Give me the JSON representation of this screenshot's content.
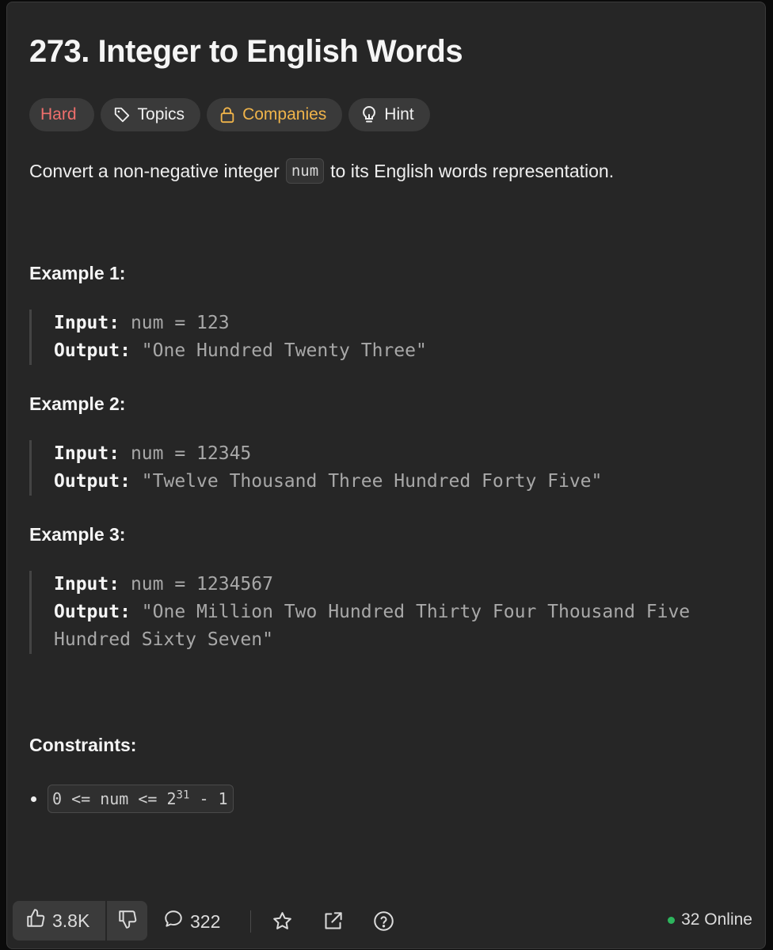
{
  "problem": {
    "title": "273. Integer to English Words",
    "tags": {
      "difficulty": "Hard",
      "topics": "Topics",
      "companies": "Companies",
      "hint": "Hint"
    },
    "description": {
      "before": "Convert a non-negative integer",
      "code": "num",
      "after": "to its English words representation."
    },
    "examples": [
      {
        "heading": "Example 1:",
        "input_label": "Input:",
        "input": "num = 123",
        "output_label": "Output:",
        "output_line1": "\"One Hundred Twenty Three\"",
        "output_line2": ""
      },
      {
        "heading": "Example 2:",
        "input_label": "Input:",
        "input": "num = 12345",
        "output_label": "Output:",
        "output_line1": "\"Twelve Thousand Three Hundred Forty Five\"",
        "output_line2": ""
      },
      {
        "heading": "Example 3:",
        "input_label": "Input:",
        "input": "num = 1234567",
        "output_label": "Output:",
        "output_line1": "\"One Million Two Hundred Thirty Four Thousand Five",
        "output_line2": "Hundred Sixty Seven\""
      }
    ],
    "constraints": {
      "heading": "Constraints:",
      "items": [
        {
          "pre": "0 <= num <= 2",
          "sup": "31",
          "post": " - 1"
        }
      ]
    }
  },
  "footer": {
    "likes": "3.8K",
    "comments": "322",
    "online": "32 Online"
  },
  "colors": {
    "hard": "#ef6f6c",
    "companies": "#f0b44a",
    "online_dot": "#2db55d"
  },
  "icons": [
    "tag-icon",
    "lock-icon",
    "lightbulb-icon",
    "thumbs-up-icon",
    "thumbs-down-icon",
    "comment-icon",
    "star-icon",
    "share-icon",
    "help-icon"
  ]
}
